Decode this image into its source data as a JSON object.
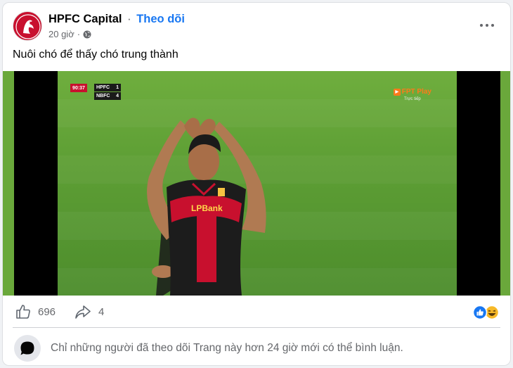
{
  "post": {
    "page_name": "HPFC Capital",
    "separator": "·",
    "follow_label": "Theo dõi",
    "time_ago": "20 giờ",
    "meta_separator": "·",
    "privacy_icon": "globe-icon",
    "caption": "Nuôi chó để thấy chó trung thành"
  },
  "video": {
    "scoreboard": {
      "time": "90:37",
      "home_team": "HPFC",
      "home_score": "1",
      "away_team": "NBFC",
      "away_score": "4"
    },
    "broadcaster": "FPT Play",
    "broadcast_status": "Trực tiếp",
    "sponsor_text": "LPBank"
  },
  "actions": {
    "like_count": "696",
    "share_count": "4",
    "reaction_icons": [
      "like-reaction-icon",
      "haha-reaction-icon"
    ]
  },
  "comment": {
    "notice": "Chỉ những người đã theo dõi Trang này hơn 24 giờ mới có thể bình luận."
  },
  "colors": {
    "follow_blue": "#1877f2",
    "secondary_text": "#65676b",
    "brand_red": "#c8102e"
  }
}
